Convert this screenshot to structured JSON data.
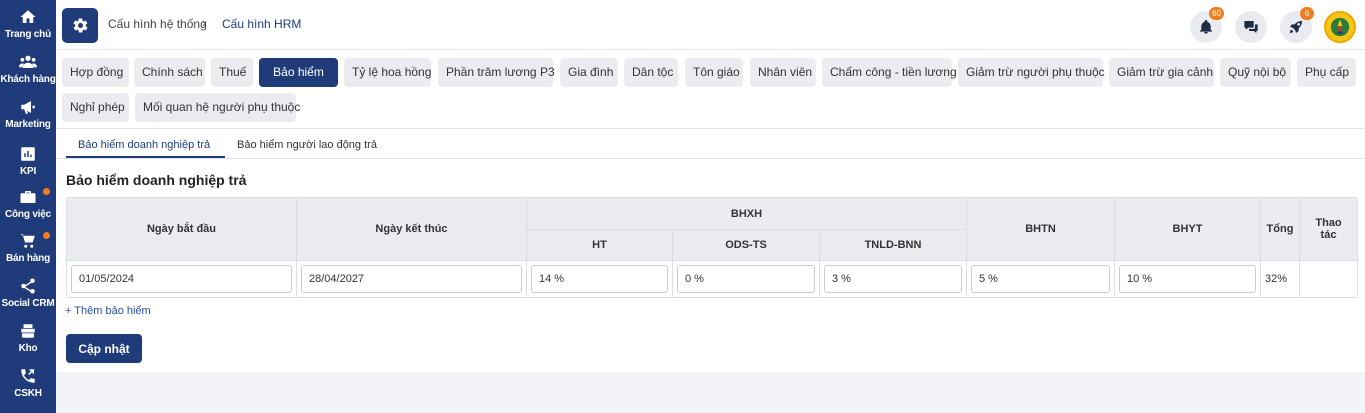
{
  "sidebar": {
    "items": [
      {
        "label": "Trang chủ",
        "icon": "home-icon"
      },
      {
        "label": "Khách hàng",
        "icon": "customers-icon"
      },
      {
        "label": "Marketing",
        "icon": "megaphone-icon"
      },
      {
        "label": "KPI",
        "icon": "chart-icon"
      },
      {
        "label": "Công việc",
        "icon": "briefcase-icon",
        "dot": true
      },
      {
        "label": "Bán hàng",
        "icon": "cart-icon",
        "dot": true
      },
      {
        "label": "Social CRM",
        "icon": "share-icon"
      },
      {
        "label": "Kho",
        "icon": "warehouse-icon"
      },
      {
        "label": "CSKH",
        "icon": "phone-icon"
      }
    ]
  },
  "header": {
    "breadcrumb": [
      "Cấu hình hệ thống",
      "Cấu hình HRM"
    ],
    "notification_count": "60",
    "rocket_count": "6"
  },
  "tabs": {
    "row1": [
      "Hợp đồng",
      "Chính sách",
      "Thuế",
      "Bảo hiểm",
      "Tỷ lệ hoa hồng",
      "Phần trăm lương P3",
      "Gia đình",
      "Dân tộc",
      "Tôn giáo",
      "Nhân viên",
      "Chấm công - tiền lương",
      "Giảm trừ người phụ thuộc",
      "Giảm trừ gia cảnh",
      "Quỹ nội bộ",
      "Phụ cấp"
    ],
    "row2": [
      "Nghỉ phép",
      "Mối quan hệ người phụ thuộc"
    ],
    "active": "Bảo hiểm"
  },
  "subtabs": [
    "Bảo hiểm doanh nghiệp trả",
    "Bảo hiểm người lao động trả"
  ],
  "section_title": "Bảo hiểm doanh nghiệp trả",
  "table": {
    "headers": {
      "start_date": "Ngày bắt đầu",
      "end_date": "Ngày kết thúc",
      "bhxh": "BHXH",
      "ht": "HT",
      "ods_ts": "ODS-TS",
      "tnld_bnn": "TNLD-BNN",
      "bhtn": "BHTN",
      "bhyt": "BHYT",
      "total": "Tổng",
      "action": "Thao tác"
    },
    "row": {
      "start_date": "01/05/2024",
      "end_date": "28/04/2027",
      "ht": "14 %",
      "ods_ts": "0 %",
      "tnld_bnn": "3 %",
      "bhtn": "5 %",
      "bhyt": "10 %",
      "total": "32%"
    }
  },
  "add_link": "+ Thêm bảo hiểm",
  "update_button": "Cập nhật",
  "colors": {
    "primary": "#1f3b7a",
    "badge": "#f07d1f",
    "tab_bg": "#ebecef"
  }
}
